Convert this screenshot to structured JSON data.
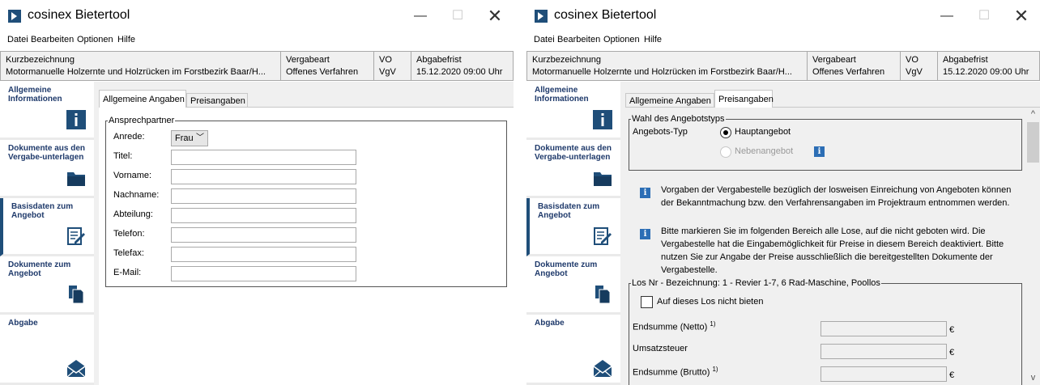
{
  "app": {
    "title": "cosinex Bietertool"
  },
  "window_controls": {
    "minimize": "—",
    "maximize": "☐",
    "close": "✕"
  },
  "menu": [
    "Datei",
    "Bearbeiten",
    "Optionen",
    "Hilfe"
  ],
  "infobar": {
    "kurzbezeichnung_label": "Kurzbezeichnung",
    "kurzbezeichnung_value": "Motormanuelle Holzernte und Holzrücken im Forstbezirk Baar/H...",
    "vergabeart_label": "Vergabeart",
    "vergabeart_value": "Offenes Verfahren",
    "vo_label": "VO",
    "vo_value": "VgV",
    "abgabefrist_label": "Abgabefrist",
    "abgabefrist_value": "15.12.2020 09:00 Uhr"
  },
  "sidebar": [
    {
      "label": "Allgemeine Informationen",
      "icon": "info-icon"
    },
    {
      "label": "Dokumente aus den Vergabe-unterlagen",
      "icon": "folder-icon"
    },
    {
      "label": "Basisdaten zum Angebot",
      "icon": "edit-form-icon"
    },
    {
      "label": "Dokumente zum Angebot",
      "icon": "documents-icon"
    },
    {
      "label": "Abgabe",
      "icon": "envelope-icon"
    }
  ],
  "tabs": [
    "Allgemeine Angaben",
    "Preisangaben"
  ],
  "left": {
    "group_title": "Ansprechpartner",
    "fields": [
      {
        "label": "Anrede:",
        "type": "select",
        "value": "Frau"
      },
      {
        "label": "Titel:",
        "value": ""
      },
      {
        "label": "Vorname:",
        "value": ""
      },
      {
        "label": "Nachname:",
        "value": ""
      },
      {
        "label": "Abteilung:",
        "value": ""
      },
      {
        "label": "Telefon:",
        "value": ""
      },
      {
        "label": "Telefax:",
        "value": ""
      },
      {
        "label": "E-Mail:",
        "value": ""
      }
    ]
  },
  "right": {
    "group_title": "Wahl des Angebotstyps",
    "angebotstyp_label": "Angebots-Typ",
    "hauptangebot": "Hauptangebot",
    "nebenangebot": "Nebenangebot",
    "note1": "Vorgaben der Vergabestelle bezüglich der losweisen Einreichung von Angeboten können der Bekanntmachung bzw. den Verfahrensangaben im Projektraum entnommen werden.",
    "note2": "Bitte markieren Sie im folgenden Bereich alle Lose, auf die nicht geboten wird. Die Vergabestelle hat die Eingabemöglichkeit für Preise in diesem Bereich deaktiviert. Bitte nutzen Sie zur Angabe der Preise ausschließlich die bereitgestellten Dokumente der Vergabestelle.",
    "los_title": "Los Nr - Bezeichnung: 1 - Revier 1-7, 6 Rad-Maschine, Poollos",
    "nicht_bieten": "Auf dieses Los nicht bieten",
    "endsumme_netto": "Endsumme (Netto)",
    "umsatzsteuer": "Umsatzsteuer",
    "endsumme_brutto": "Endsumme (Brutto)",
    "footnote_mark": "1)",
    "currency": "€"
  },
  "colors": {
    "brand": "#1f4e79",
    "info": "#2c6eb5",
    "sidebar_bg": "#eaeaea",
    "content_bg": "#f0f0f0"
  }
}
